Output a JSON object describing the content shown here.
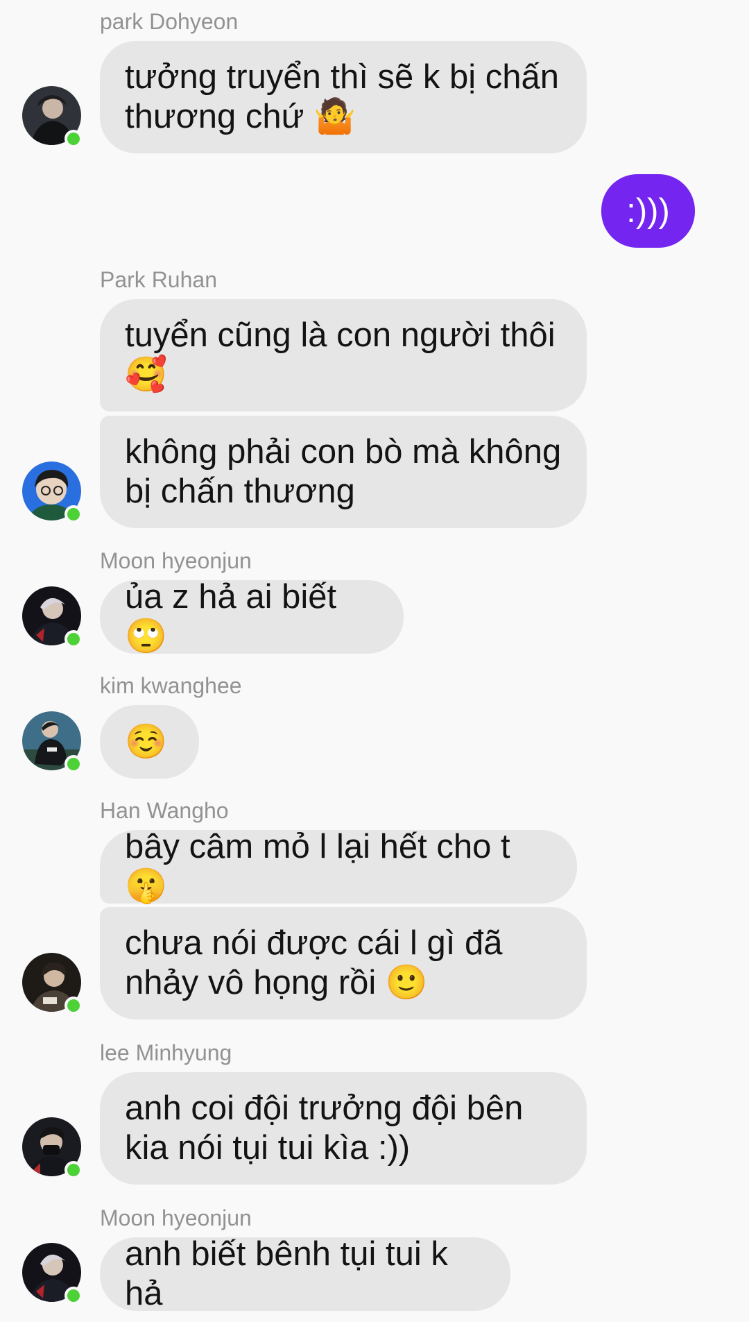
{
  "colors": {
    "background": "#f9f9fa",
    "incoming_bubble": "#e6e6e7",
    "outgoing_bubble": "#7425f0",
    "online_dot": "#4cd137",
    "sender_name": "#929292"
  },
  "messages": [
    {
      "sender": "park Dohyeon",
      "texts": [
        "tưởng truyển thì sẽ k bị chấn thương chứ 🤷"
      ],
      "avatar_icon": "profile-photo",
      "online": true
    },
    {
      "sender": "",
      "outgoing": true,
      "texts": [
        ":)))"
      ]
    },
    {
      "sender": "Park Ruhan",
      "texts": [
        "tuyển cũng là con người thôi 🥰",
        "không phải con bò mà không bị chấn thương"
      ],
      "avatar_icon": "profile-photo",
      "online": true
    },
    {
      "sender": "Moon hyeonjun",
      "texts": [
        "ủa z hả ai biết 🙄"
      ],
      "avatar_icon": "profile-photo",
      "online": true
    },
    {
      "sender": "kim kwanghee",
      "texts": [
        "☺️"
      ],
      "avatar_icon": "profile-photo",
      "online": true
    },
    {
      "sender": "Han Wangho",
      "texts": [
        "bây câm mỏ l lại hết cho t 🤫",
        "chưa nói được cái l gì đã nhảy vô họng rồi 🙂"
      ],
      "avatar_icon": "profile-photo",
      "online": true
    },
    {
      "sender": "lee Minhyung",
      "texts": [
        "anh coi đội trưởng đội bên kia nói tụi tui kìa :))"
      ],
      "avatar_icon": "profile-photo",
      "online": true
    },
    {
      "sender": "Moon hyeonjun",
      "texts": [
        "anh biết bênh tụi tui k hả"
      ],
      "avatar_icon": "profile-photo",
      "online": true
    }
  ]
}
